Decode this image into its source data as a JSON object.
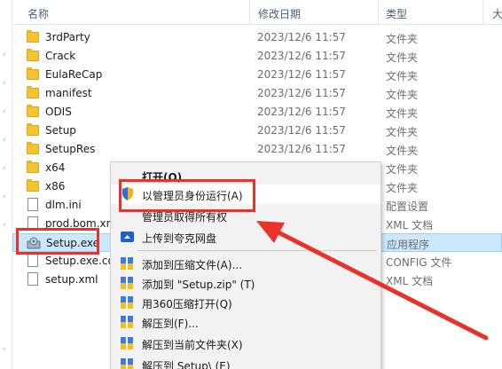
{
  "header": {
    "col_name": "名称",
    "col_date": "修改日期",
    "col_type": "类型",
    "col_size": "大"
  },
  "files": [
    {
      "name": "3rdParty",
      "date": "2023/12/6 11:57",
      "type": "文件夹",
      "kind": "folder"
    },
    {
      "name": "Crack",
      "date": "2023/12/6 11:57",
      "type": "文件夹",
      "kind": "folder"
    },
    {
      "name": "EulaReCap",
      "date": "2023/12/6 11:57",
      "type": "文件夹",
      "kind": "folder"
    },
    {
      "name": "manifest",
      "date": "2023/12/6 11:57",
      "type": "文件夹",
      "kind": "folder"
    },
    {
      "name": "ODIS",
      "date": "2023/12/6 11:57",
      "type": "文件夹",
      "kind": "folder"
    },
    {
      "name": "Setup",
      "date": "2023/12/6 11:57",
      "type": "文件夹",
      "kind": "folder"
    },
    {
      "name": "SetupRes",
      "date": "2023/12/6 11:57",
      "type": "文件夹",
      "kind": "folder"
    },
    {
      "name": "x64",
      "date": "",
      "type": "文件夹",
      "kind": "folder"
    },
    {
      "name": "x86",
      "date": "",
      "type": "文件夹",
      "kind": "folder"
    },
    {
      "name": "dlm.ini",
      "date": "",
      "type": "配置设置",
      "kind": "file"
    },
    {
      "name": "prod.bom.xn",
      "date": "",
      "type": "XML 文档",
      "kind": "file"
    },
    {
      "name": "Setup.exe",
      "date": "",
      "type": "应用程序",
      "kind": "exe"
    },
    {
      "name": "Setup.exe.co",
      "date": "",
      "type": "CONFIG 文件",
      "kind": "file"
    },
    {
      "name": "setup.xml",
      "date": "",
      "type": "XML 文档",
      "kind": "file"
    }
  ],
  "context_menu": {
    "open": "打开(O)",
    "run_as_admin": "以管理员身份运行(A)",
    "take_ownership": "管理员取得所有权",
    "upload": "上传到夸克网盘",
    "add_archive": "添加到压缩文件(A)...",
    "add_zip": "添加到 \"Setup.zip\" (T)",
    "open_360": "用360压缩打开(Q)",
    "extract_to": "解压到(F)...",
    "extract_here": "解压到当前文件夹(X)",
    "extract_folder": "解压到 Setup\\ (E)"
  },
  "colors": {
    "accent_red": "#e8332a",
    "selection": "#cce8ff",
    "folder": "#f4c430"
  }
}
